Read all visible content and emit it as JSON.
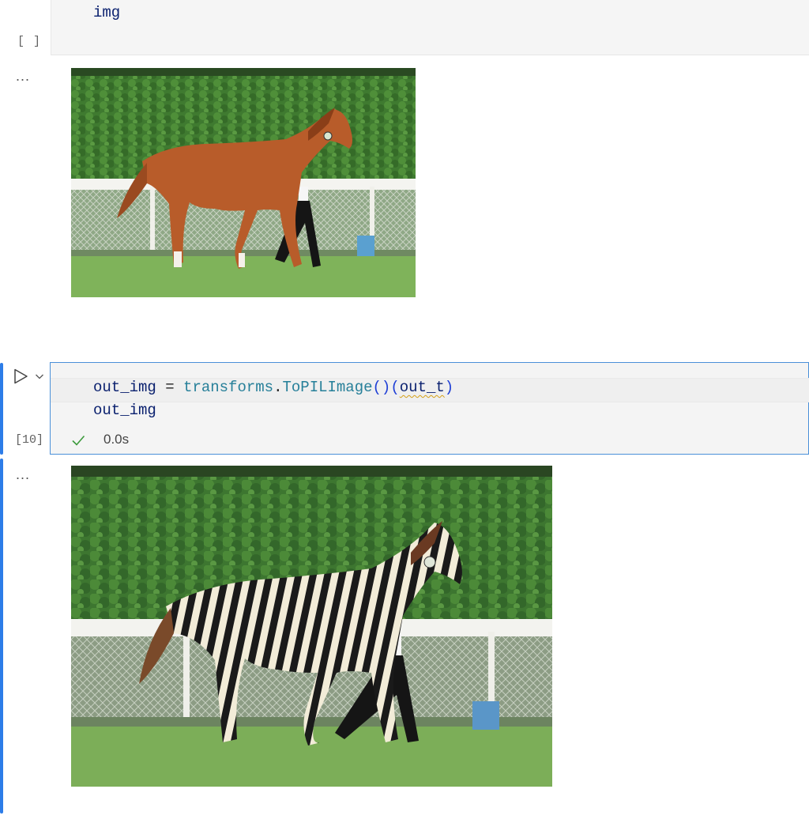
{
  "cell1": {
    "code_line": "img",
    "execution_count": "[ ]",
    "output_prompt": "..."
  },
  "cell2": {
    "code_line1_tokens": [
      "out_img",
      " = ",
      "transforms",
      ".",
      "ToPILImage",
      "()",
      "(",
      "out_t",
      ")"
    ],
    "code_line2": "out_img",
    "execution_count": "[10]",
    "status": "success",
    "execution_time": "0.0s",
    "output_prompt": "..."
  },
  "icons": {
    "run": "run-cell-play-icon",
    "expand": "chevron-down-icon",
    "success": "checkmark-icon"
  },
  "colors": {
    "accent": "#2d7de8",
    "success": "#3c9a3c",
    "code_variable": "#0b216f",
    "code_type": "#267f99"
  },
  "outputs": {
    "image1_subject": "horse",
    "image2_subject": "zebra"
  }
}
